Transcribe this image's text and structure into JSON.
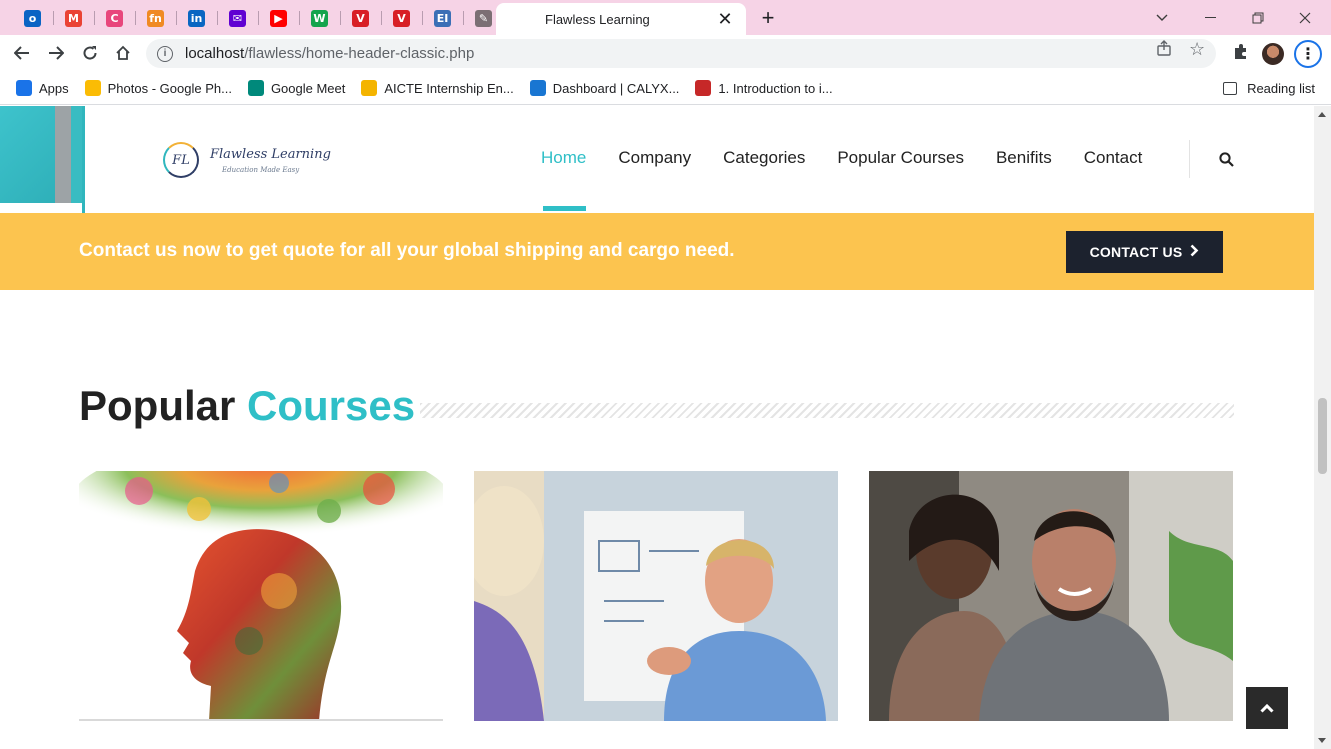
{
  "browser": {
    "pinned_tabs": [
      {
        "icon": "outlook-icon",
        "glyph": "o",
        "color": "#0a64c4"
      },
      {
        "icon": "gmail-icon",
        "glyph": "M",
        "color": "#ea4335"
      },
      {
        "icon": "copilot-icon",
        "glyph": "C",
        "color": "#e8467c"
      },
      {
        "icon": "fn-icon",
        "glyph": "fn",
        "color": "#f08a24"
      },
      {
        "icon": "linkedin-icon",
        "glyph": "in",
        "color": "#0a66c2"
      },
      {
        "icon": "yahoo-mail-icon",
        "glyph": "✉",
        "color": "#6001d2"
      },
      {
        "icon": "youtube-icon",
        "glyph": "▶",
        "color": "#ff0000"
      },
      {
        "icon": "w-icon",
        "glyph": "W",
        "color": "#14a44d"
      },
      {
        "icon": "v-icon-1",
        "glyph": "V",
        "color": "#d81f26"
      },
      {
        "icon": "v-icon-2",
        "glyph": "V",
        "color": "#d81f26"
      },
      {
        "icon": "ei-icon",
        "glyph": "EI",
        "color": "#3b6fb6"
      },
      {
        "icon": "feather-icon",
        "glyph": "✎",
        "color": "#7b6f74"
      }
    ],
    "active_tab_title": "Flawless Learning",
    "url_host": "localhost",
    "url_path": "/flawless/home-header-classic.php",
    "bookmarks": [
      {
        "label": "Apps",
        "icon": "apps-grid-icon",
        "color": "#1a73e8"
      },
      {
        "label": "Photos - Google Ph...",
        "icon": "google-photos-icon",
        "color": "#fbbc04"
      },
      {
        "label": "Google Meet",
        "icon": "google-meet-icon",
        "color": "#00897b"
      },
      {
        "label": "AICTE Internship En...",
        "icon": "aicte-icon",
        "color": "#f4b400"
      },
      {
        "label": "Dashboard | CALYX...",
        "icon": "calyx-icon",
        "color": "#1976d2"
      },
      {
        "label": "1. Introduction to i...",
        "icon": "course-icon",
        "color": "#c62828"
      }
    ],
    "reading_list": "Reading list"
  },
  "site": {
    "logo_mark": "FL",
    "logo_name": "Flawless Learning",
    "logo_tagline": "Education Made Easy",
    "nav": [
      "Home",
      "Company",
      "Categories",
      "Popular Courses",
      "Benifits",
      "Contact"
    ],
    "active_nav": "Home",
    "banner_text": "Contact us now to get quote for all your global shipping and cargo need.",
    "contact_button": "CONTACT US",
    "section_title_part1": "Popular",
    "section_title_part2": "Courses",
    "colors": {
      "accent": "#2fbfc7",
      "banner": "#fcc44f",
      "button_dark": "#1c222e"
    }
  }
}
